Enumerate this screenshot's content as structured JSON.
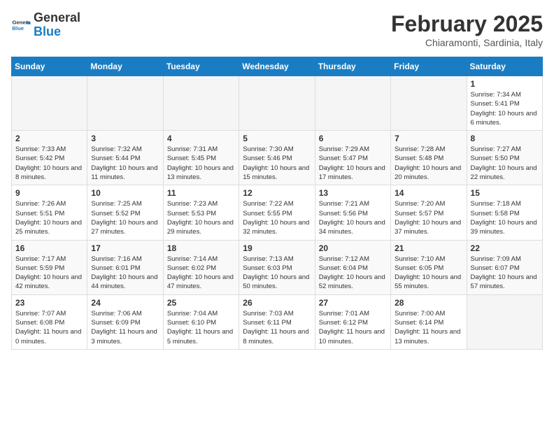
{
  "header": {
    "logo_general": "General",
    "logo_blue": "Blue",
    "month_title": "February 2025",
    "location": "Chiaramonti, Sardinia, Italy"
  },
  "days_of_week": [
    "Sunday",
    "Monday",
    "Tuesday",
    "Wednesday",
    "Thursday",
    "Friday",
    "Saturday"
  ],
  "weeks": [
    [
      {
        "day": "",
        "info": ""
      },
      {
        "day": "",
        "info": ""
      },
      {
        "day": "",
        "info": ""
      },
      {
        "day": "",
        "info": ""
      },
      {
        "day": "",
        "info": ""
      },
      {
        "day": "",
        "info": ""
      },
      {
        "day": "1",
        "info": "Sunrise: 7:34 AM\nSunset: 5:41 PM\nDaylight: 10 hours and 6 minutes."
      }
    ],
    [
      {
        "day": "2",
        "info": "Sunrise: 7:33 AM\nSunset: 5:42 PM\nDaylight: 10 hours and 8 minutes."
      },
      {
        "day": "3",
        "info": "Sunrise: 7:32 AM\nSunset: 5:44 PM\nDaylight: 10 hours and 11 minutes."
      },
      {
        "day": "4",
        "info": "Sunrise: 7:31 AM\nSunset: 5:45 PM\nDaylight: 10 hours and 13 minutes."
      },
      {
        "day": "5",
        "info": "Sunrise: 7:30 AM\nSunset: 5:46 PM\nDaylight: 10 hours and 15 minutes."
      },
      {
        "day": "6",
        "info": "Sunrise: 7:29 AM\nSunset: 5:47 PM\nDaylight: 10 hours and 17 minutes."
      },
      {
        "day": "7",
        "info": "Sunrise: 7:28 AM\nSunset: 5:48 PM\nDaylight: 10 hours and 20 minutes."
      },
      {
        "day": "8",
        "info": "Sunrise: 7:27 AM\nSunset: 5:50 PM\nDaylight: 10 hours and 22 minutes."
      }
    ],
    [
      {
        "day": "9",
        "info": "Sunrise: 7:26 AM\nSunset: 5:51 PM\nDaylight: 10 hours and 25 minutes."
      },
      {
        "day": "10",
        "info": "Sunrise: 7:25 AM\nSunset: 5:52 PM\nDaylight: 10 hours and 27 minutes."
      },
      {
        "day": "11",
        "info": "Sunrise: 7:23 AM\nSunset: 5:53 PM\nDaylight: 10 hours and 29 minutes."
      },
      {
        "day": "12",
        "info": "Sunrise: 7:22 AM\nSunset: 5:55 PM\nDaylight: 10 hours and 32 minutes."
      },
      {
        "day": "13",
        "info": "Sunrise: 7:21 AM\nSunset: 5:56 PM\nDaylight: 10 hours and 34 minutes."
      },
      {
        "day": "14",
        "info": "Sunrise: 7:20 AM\nSunset: 5:57 PM\nDaylight: 10 hours and 37 minutes."
      },
      {
        "day": "15",
        "info": "Sunrise: 7:18 AM\nSunset: 5:58 PM\nDaylight: 10 hours and 39 minutes."
      }
    ],
    [
      {
        "day": "16",
        "info": "Sunrise: 7:17 AM\nSunset: 5:59 PM\nDaylight: 10 hours and 42 minutes."
      },
      {
        "day": "17",
        "info": "Sunrise: 7:16 AM\nSunset: 6:01 PM\nDaylight: 10 hours and 44 minutes."
      },
      {
        "day": "18",
        "info": "Sunrise: 7:14 AM\nSunset: 6:02 PM\nDaylight: 10 hours and 47 minutes."
      },
      {
        "day": "19",
        "info": "Sunrise: 7:13 AM\nSunset: 6:03 PM\nDaylight: 10 hours and 50 minutes."
      },
      {
        "day": "20",
        "info": "Sunrise: 7:12 AM\nSunset: 6:04 PM\nDaylight: 10 hours and 52 minutes."
      },
      {
        "day": "21",
        "info": "Sunrise: 7:10 AM\nSunset: 6:05 PM\nDaylight: 10 hours and 55 minutes."
      },
      {
        "day": "22",
        "info": "Sunrise: 7:09 AM\nSunset: 6:07 PM\nDaylight: 10 hours and 57 minutes."
      }
    ],
    [
      {
        "day": "23",
        "info": "Sunrise: 7:07 AM\nSunset: 6:08 PM\nDaylight: 11 hours and 0 minutes."
      },
      {
        "day": "24",
        "info": "Sunrise: 7:06 AM\nSunset: 6:09 PM\nDaylight: 11 hours and 3 minutes."
      },
      {
        "day": "25",
        "info": "Sunrise: 7:04 AM\nSunset: 6:10 PM\nDaylight: 11 hours and 5 minutes."
      },
      {
        "day": "26",
        "info": "Sunrise: 7:03 AM\nSunset: 6:11 PM\nDaylight: 11 hours and 8 minutes."
      },
      {
        "day": "27",
        "info": "Sunrise: 7:01 AM\nSunset: 6:12 PM\nDaylight: 11 hours and 10 minutes."
      },
      {
        "day": "28",
        "info": "Sunrise: 7:00 AM\nSunset: 6:14 PM\nDaylight: 11 hours and 13 minutes."
      },
      {
        "day": "",
        "info": ""
      }
    ]
  ]
}
